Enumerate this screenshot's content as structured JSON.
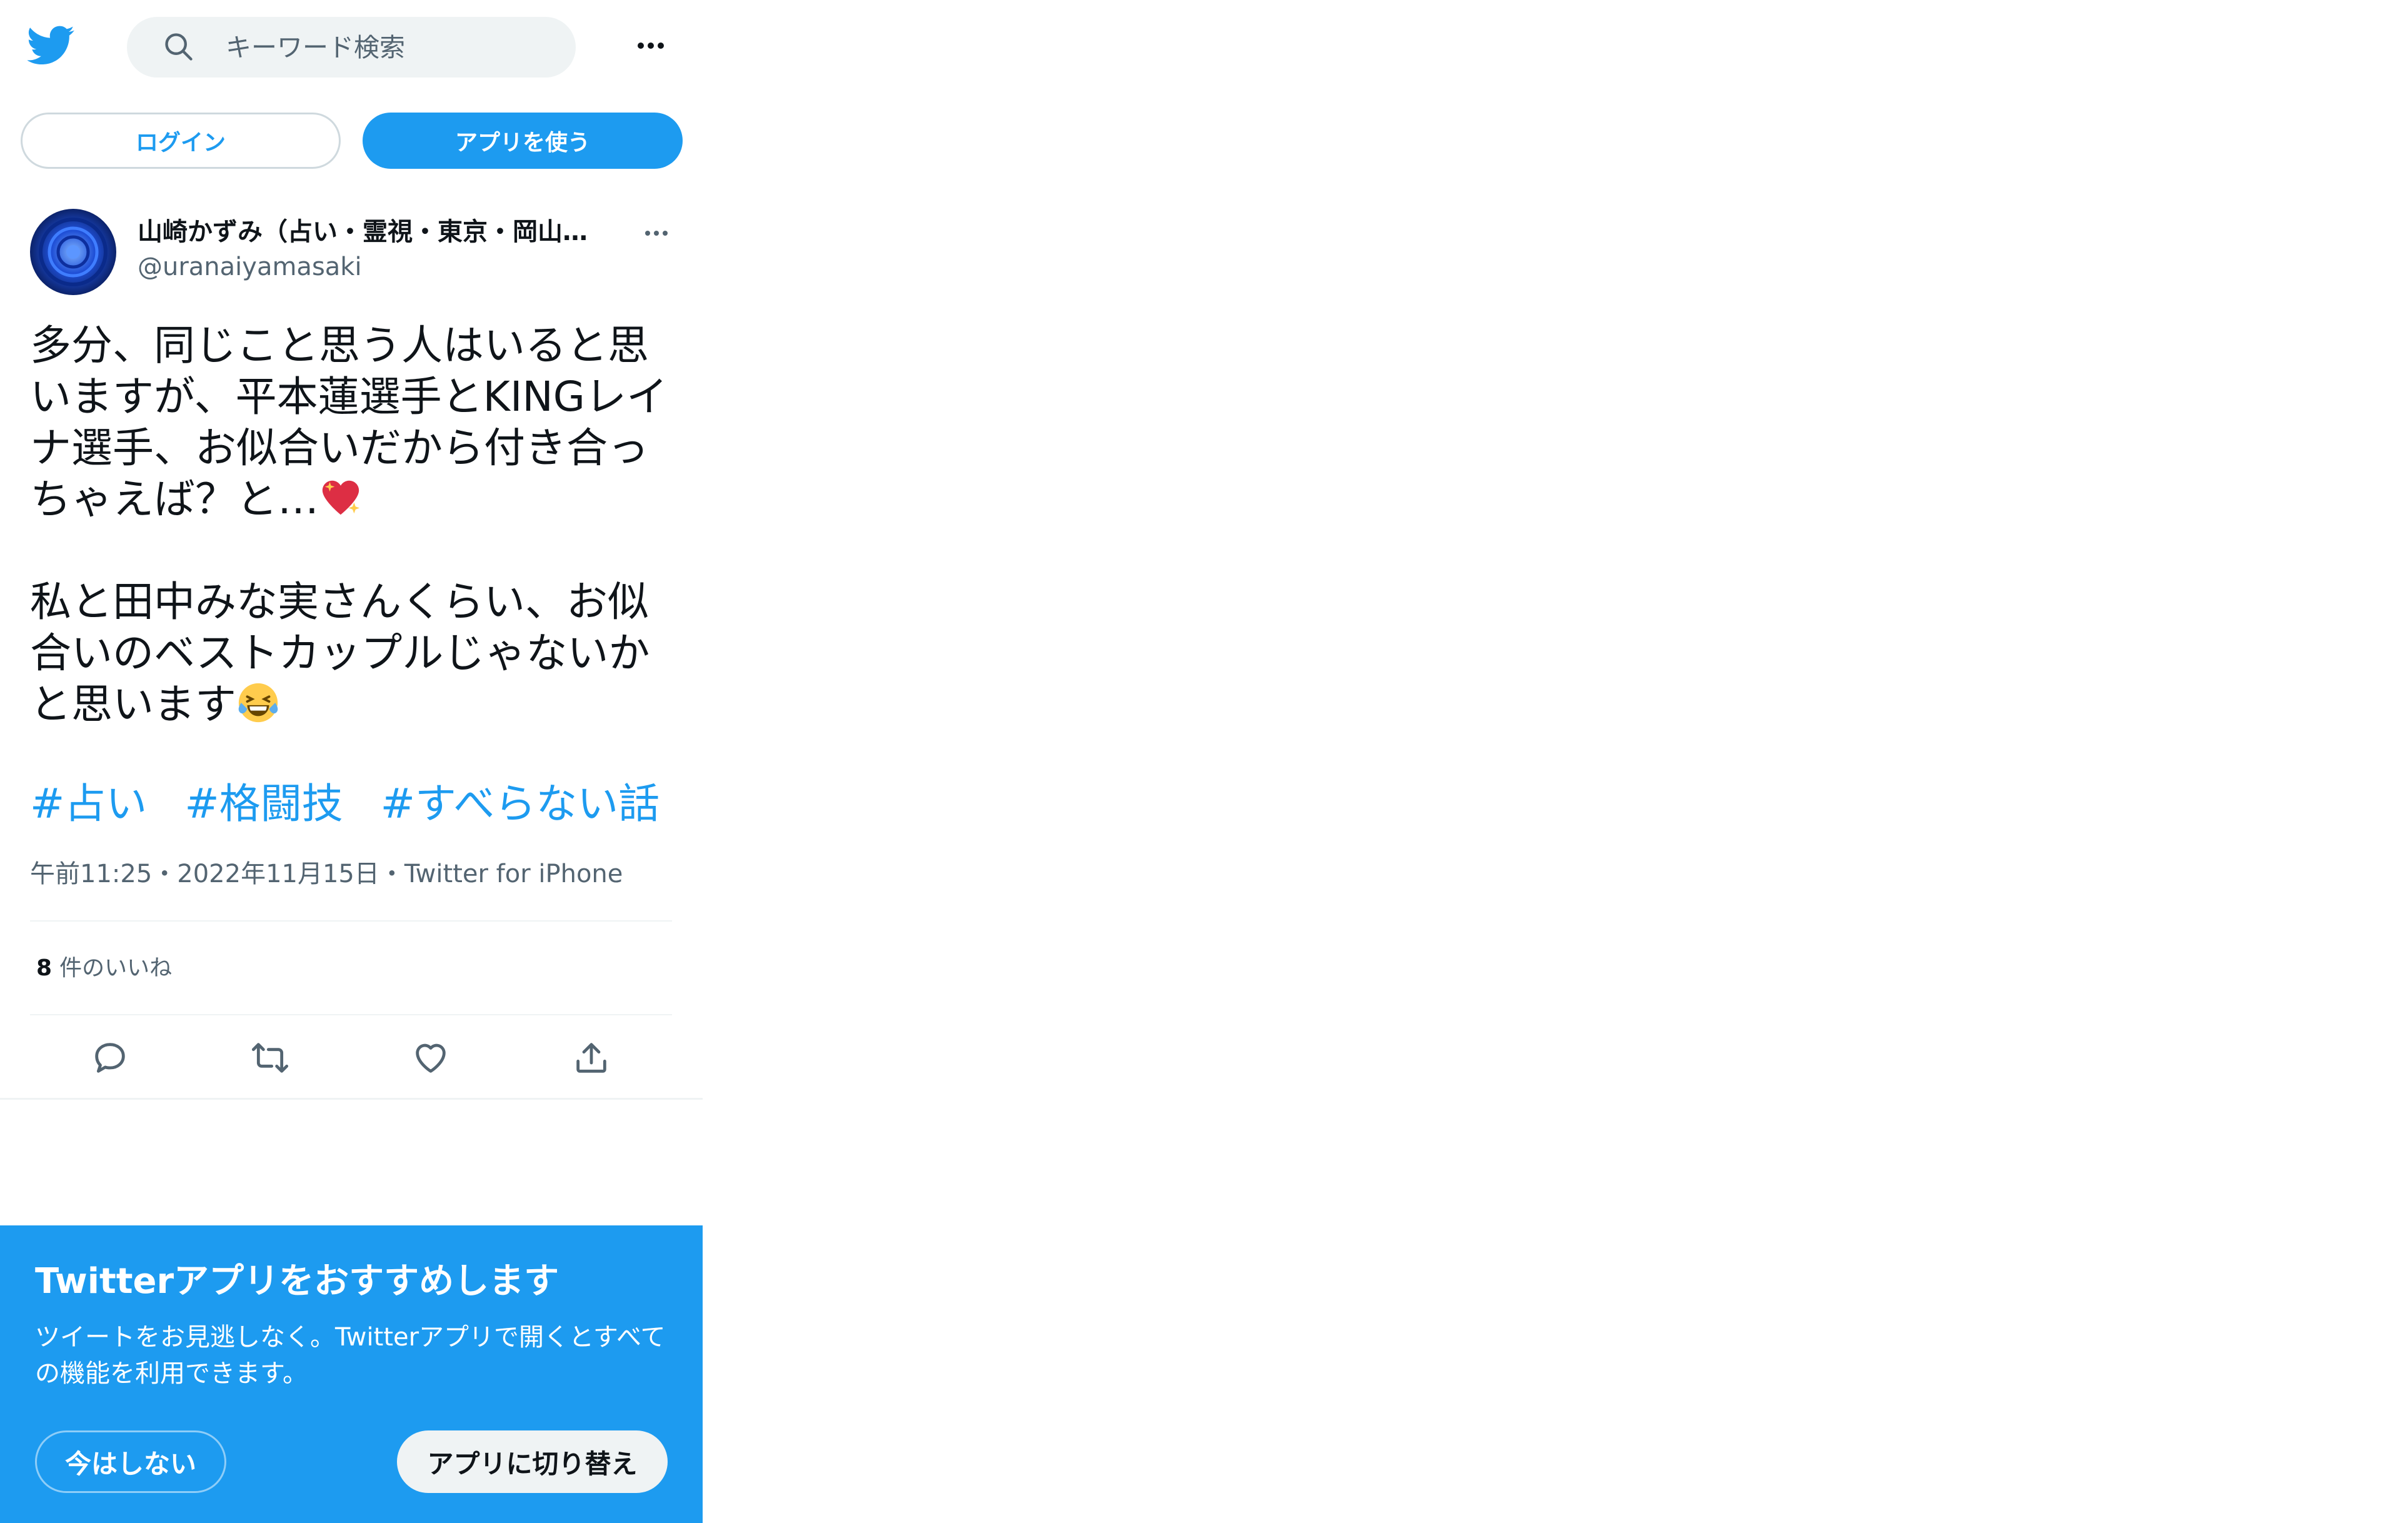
{
  "header": {
    "search_placeholder": "キーワード検索"
  },
  "auth": {
    "login_label": "ログイン",
    "use_app_label": "アプリを使う"
  },
  "tweet": {
    "display_name": "山崎かずみ（占い・霊視・東京・岡山…",
    "handle": "@uranaiyamasaki",
    "text_p1": "多分、同じこと思う人はいると思いますが、平本蓮選手とKINGレイナ選手、お似合いだから付き合っちゃえば？と…",
    "text_p2": "私と田中みな実さんくらい、お似合いのベストカップルじゃないかと思います",
    "hashtags": [
      "#占い",
      "#格闘技",
      "#すべらない話"
    ],
    "meta": "午前11:25・2022年11月15日・Twitter for iPhone",
    "like_count": "8",
    "like_label": "件のいいね"
  },
  "promo": {
    "title": "Twitterアプリをおすすめします",
    "body": "ツイートをお見逃しなく。Twitterアプリで開くとすべての機能を利用できます。",
    "not_now_label": "今はしない",
    "switch_label": "アプリに切り替え"
  },
  "colors": {
    "accent": "#1d9bf0",
    "text_primary": "#0f1419",
    "text_secondary": "#536471",
    "border": "#cfd9de"
  },
  "icons": {
    "logo": "twitter-bird-icon",
    "search": "search-icon",
    "more": "more-horizontal-icon",
    "reply": "reply-icon",
    "retweet": "retweet-icon",
    "like": "heart-icon",
    "share": "share-icon",
    "emoji1": "sparkling-heart-emoji",
    "emoji2": "tears-of-joy-emoji"
  }
}
